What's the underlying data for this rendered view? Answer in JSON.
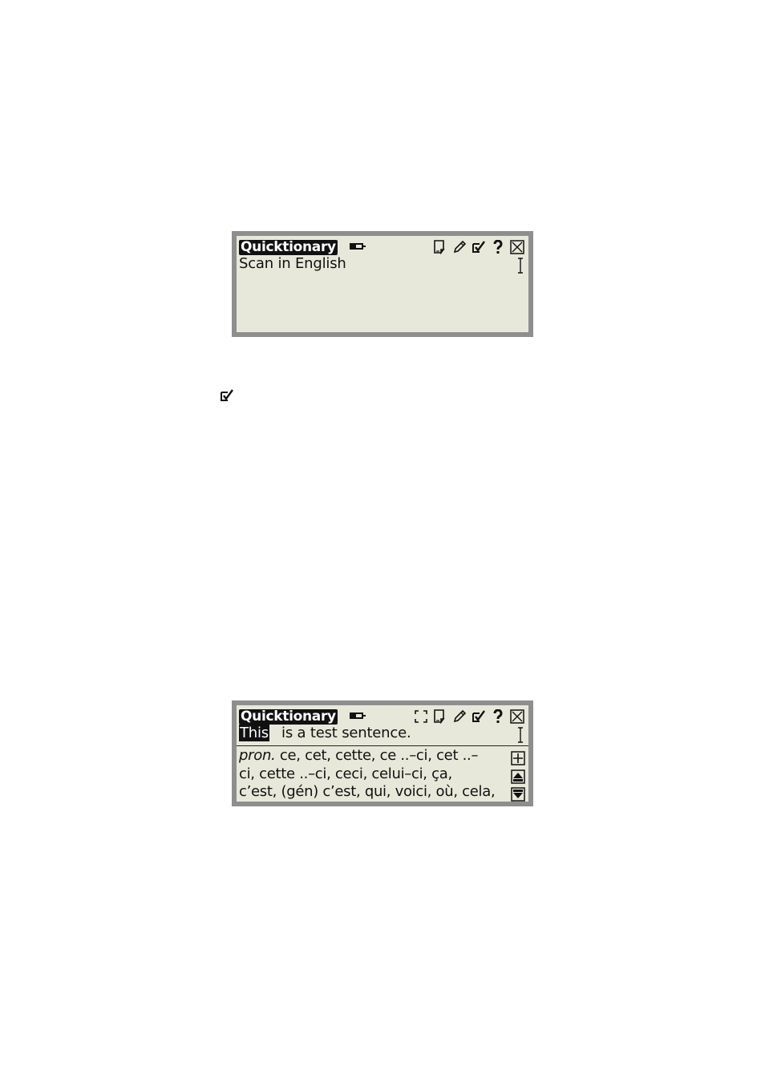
{
  "screen1": {
    "app_title": "Quicktionary",
    "prompt_text": "Scan in English",
    "toolbar_icons": [
      "notepad-icon",
      "pencil-icon",
      "scan-check-icon",
      "help-icon",
      "close-icon"
    ]
  },
  "standalone_icon": "scan-check-icon",
  "screen2": {
    "app_title": "Quicktionary",
    "highlighted_word": "This",
    "sentence_rest": "is a test sentence.",
    "definition_pos": "pron.",
    "definition_lines": [
      " ce, cet, cette, ce ..–ci, cet ..–",
      "ci, cette ..–ci, ceci, celui–ci, ça,",
      "c’est, (gén) c’est, qui, voici, où, cela,"
    ],
    "toolbar_icons": [
      "fullscreen-icon",
      "notepad-icon",
      "pencil-icon",
      "scan-check-icon",
      "help-icon",
      "close-icon"
    ],
    "side_buttons": [
      "expand-plus-icon",
      "scroll-up-icon",
      "scroll-down-icon"
    ]
  }
}
